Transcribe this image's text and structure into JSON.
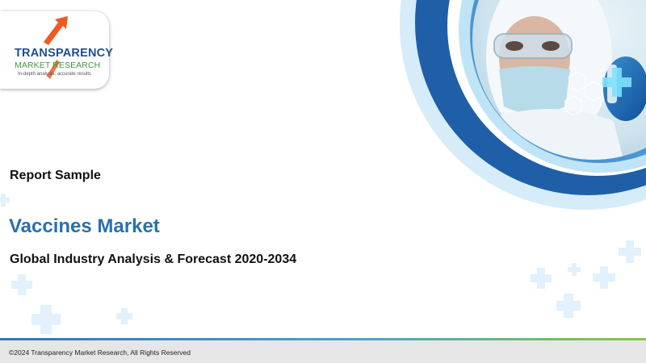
{
  "logo": {
    "name_line1": "TRANSPARENCY",
    "name_line2": "MARKET RESEARCH",
    "tagline": "In-depth analysis, accurate results"
  },
  "report": {
    "label": "Report Sample",
    "title": "Vaccines Market",
    "subtitle": "Global Industry Analysis & Forecast 2020-2034"
  },
  "footer": {
    "copyright": "©2024 Transparency Market Research, All Rights Reserved"
  },
  "colors": {
    "title_blue": "#2a6fb2",
    "arc_dark": "#1f5fa8",
    "arc_light": "#bfe4f6",
    "logo_blue": "#1e4f8f",
    "logo_green": "#3f9a3f",
    "logo_orange": "#f05a22"
  },
  "icons": [
    "medical-cross-icon",
    "hexagon-molecule-icon",
    "growth-arrow-icon"
  ]
}
